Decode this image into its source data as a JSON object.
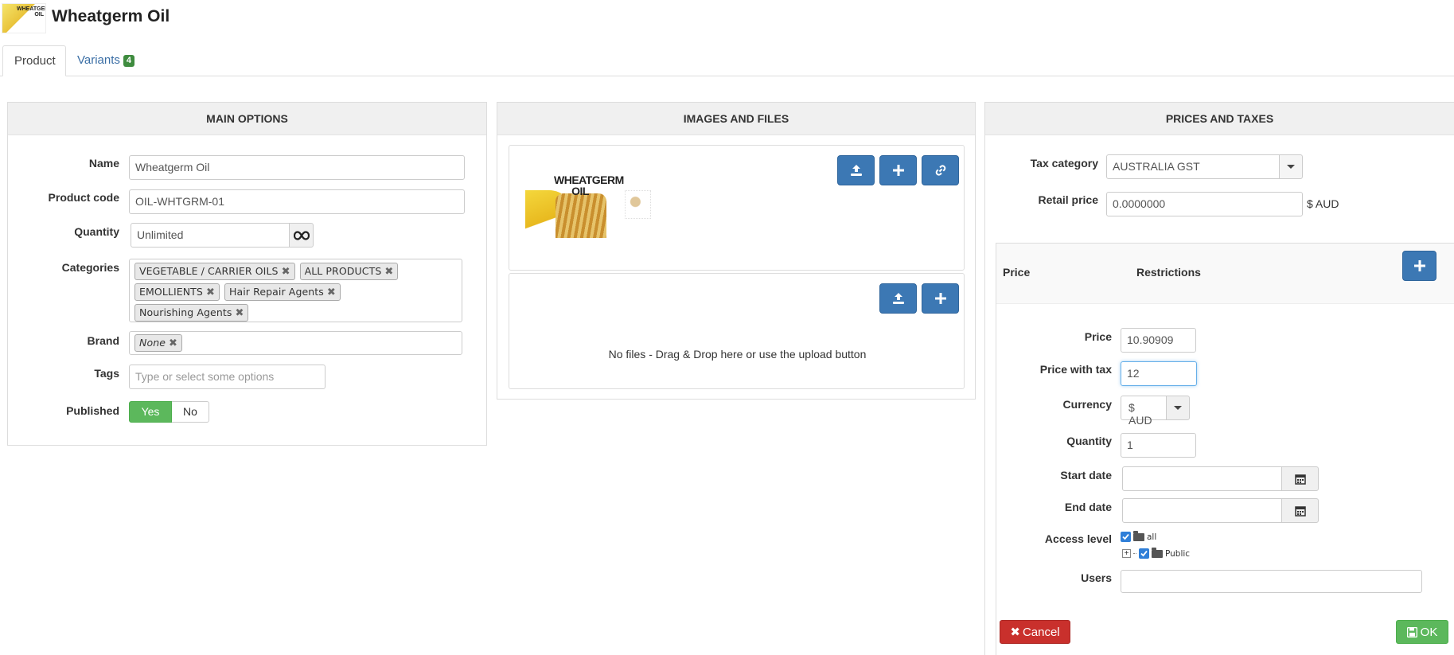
{
  "header": {
    "title": "Wheatgerm Oil",
    "logo_text": "WHEATGERM OIL"
  },
  "tabs": [
    {
      "label": "Product",
      "active": true
    },
    {
      "label": "Variants",
      "badge": "4"
    }
  ],
  "main_options": {
    "heading": "MAIN OPTIONS",
    "name_label": "Name",
    "name_value": "Wheatgerm Oil",
    "code_label": "Product code",
    "code_value": "OIL-WHTGRM-01",
    "quantity_label": "Quantity",
    "quantity_value": "Unlimited",
    "categories_label": "Categories",
    "categories": [
      "VEGETABLE / CARRIER OILS",
      "ALL PRODUCTS",
      "EMOLLIENTS",
      "Hair Repair Agents",
      "Nourishing Agents"
    ],
    "brand_label": "Brand",
    "brand_value": "None",
    "tags_label": "Tags",
    "tags_placeholder": "Type or select some options",
    "published_label": "Published",
    "yes_label": "Yes",
    "no_label": "No"
  },
  "images": {
    "heading": "IMAGES AND FILES",
    "image_text": "WHEATGERM OIL",
    "files_empty": "No files - Drag & Drop here or use the upload button"
  },
  "prices": {
    "heading": "PRICES AND TAXES",
    "tax_label": "Tax category",
    "tax_value": "AUSTRALIA GST",
    "retail_label": "Retail price",
    "retail_value": "0.0000000",
    "retail_unit": "$ AUD",
    "col_price": "Price",
    "col_restrictions": "Restrictions",
    "price_label": "Price",
    "price_value": "10.90909",
    "price_tax_label": "Price with tax",
    "price_tax_value": "12",
    "currency_label": "Currency",
    "currency_value": "$ AUD",
    "quantity_label": "Quantity",
    "quantity_value": "1",
    "start_label": "Start date",
    "end_label": "End date",
    "access_label": "Access level",
    "access_all": "all",
    "access_public": "Public",
    "users_label": "Users",
    "cancel_label": "Cancel",
    "ok_label": "OK"
  },
  "colors": {
    "primary": "#3c78b4",
    "success": "#5cb85c",
    "danger": "#c9302c"
  }
}
